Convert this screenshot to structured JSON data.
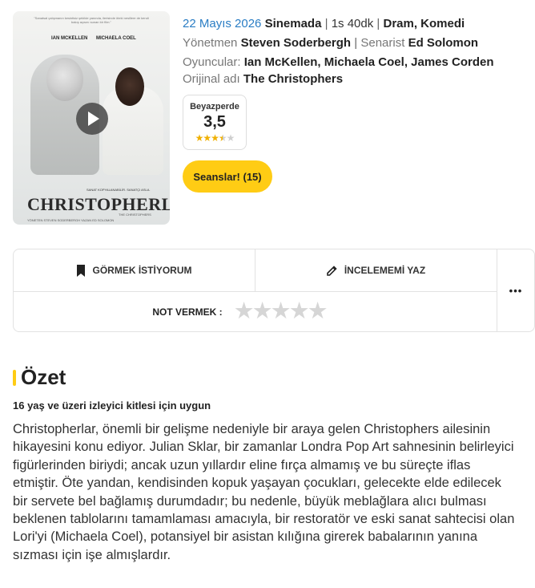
{
  "poster": {
    "tagline": "\"Sanatsal çalışmanın kesintisiz şekilde yanında, ilerisinde öteki nesillere de kendi bakış açısını sunan bir film.\"",
    "actor_left": "IAN MCKELLEN",
    "actor_right": "MICHAELA COEL",
    "small_credit": "SANAT KOPYALANABİLİR. SANATÇI ASLA.",
    "title": "CHRISTOPHERLAR",
    "original_small": "THE CHRISTOPHERS",
    "credits_line": "YÖNETEN STEVEN SODERBERGH  YAZAN ED SOLOMON"
  },
  "info": {
    "date": "22 Mayıs 2026",
    "status": "Sinemada",
    "duration": "1s 40dk",
    "genres": "Dram, Komedi",
    "director_label": "Yönetmen",
    "director": "Steven Soderbergh",
    "writer_label": "Senarist",
    "writer": "Ed Solomon",
    "cast_label": "Oyuncular:",
    "cast": [
      "Ian McKellen",
      "Michaela Coel",
      "James Corden"
    ],
    "original_label": "Orijinal adı",
    "original_title": "The Christophers"
  },
  "rating": {
    "source": "Beyazperde",
    "score": "3,5",
    "stars_value": 3.5,
    "stars_max": 5
  },
  "sessions_button": "Seanslar! (15)",
  "actions": {
    "want_to_see": "GÖRMEK İSTİYORUM",
    "write_review": "İNCELEMEMİ YAZ",
    "more": "•••",
    "vote_label": "NOT VERMEK :"
  },
  "summary": {
    "title": "Özet",
    "age_rating": "16 yaş ve üzeri izleyici kitlesi için uygun",
    "text": "Christopherlar, önemli bir gelişme nedeniyle bir araya gelen Christophers ailesinin hikayesini konu ediyor. Julian Sklar, bir zamanlar Londra Pop Art sahnesinin belirleyici figürlerinden biriydi; ancak uzun yıllardır eline fırça almamış ve bu süreçte iflas etmiştir. Öte yandan, kendisinden kopuk yaşayan çocukları, gelecekte elde edilecek bir servete bel bağlamış durumdadır; bu nedenle, büyük meblağlara alıcı bulması beklenen tablolarını tamamlaması amacıyla, bir restoratör ve eski sanat sahtecisi olan Lori'yi (Michaela Coel), potansiyel bir asistan kılığına girerek babalarının yanına sızması için işe almışlardır."
  },
  "colors": {
    "accent": "#ffcc14",
    "link_blue": "#2a7dc4",
    "star": "#f0b000"
  }
}
